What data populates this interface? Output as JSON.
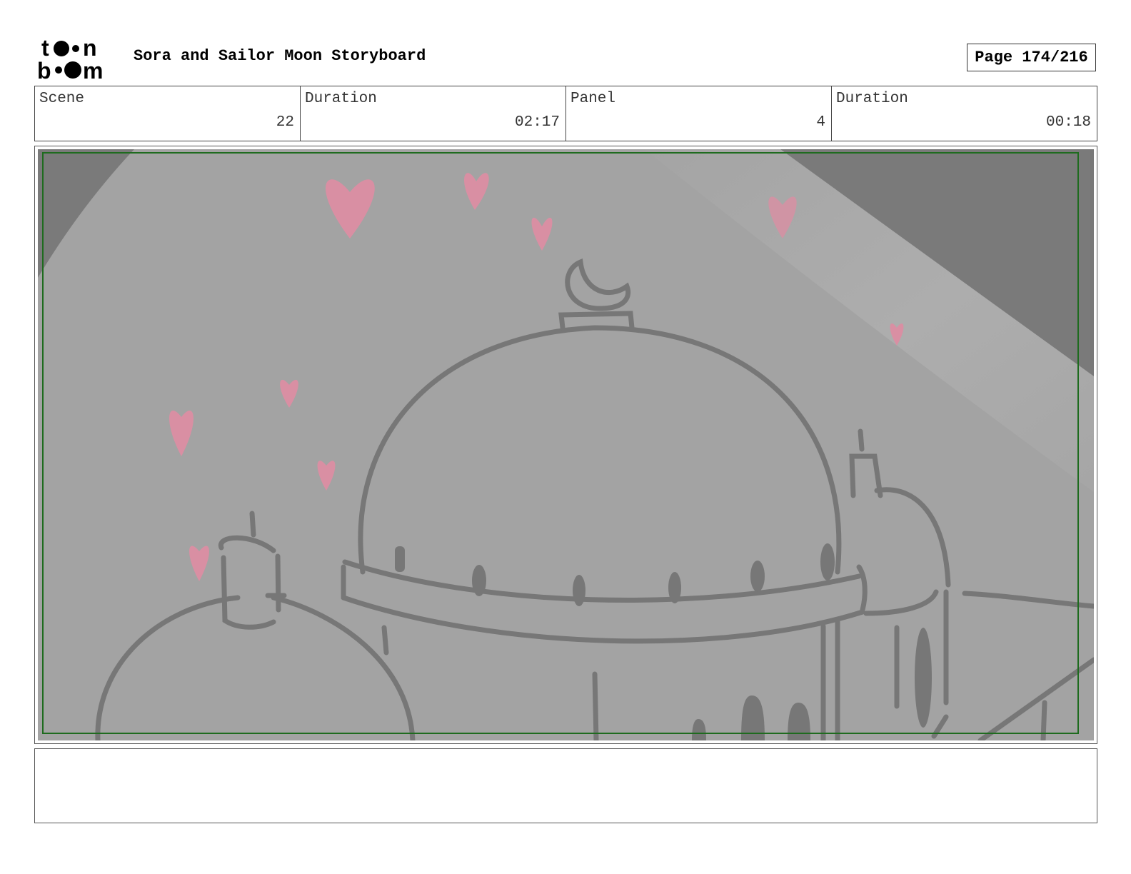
{
  "header": {
    "title": "Sora and Sailor Moon Storyboard",
    "page_label": "Page 174/216"
  },
  "logo": {
    "name": "toon boom",
    "color": "#000000"
  },
  "info": [
    {
      "label": "Scene",
      "value": "22"
    },
    {
      "label": "Duration",
      "value": "02:17"
    },
    {
      "label": "Panel",
      "value": "4"
    },
    {
      "label": "Duration",
      "value": "00:18"
    }
  ],
  "panel": {
    "description_icons": [
      "heart-icon",
      "crescent-moon-icon",
      "dome-icon"
    ],
    "colors": {
      "background": "#a3a3a3",
      "shadow": "#7a7a7a",
      "line": "#777777",
      "heart": "#d98fa3",
      "safe_frame": "#1e6b1e"
    }
  },
  "notes": {
    "text": ""
  }
}
